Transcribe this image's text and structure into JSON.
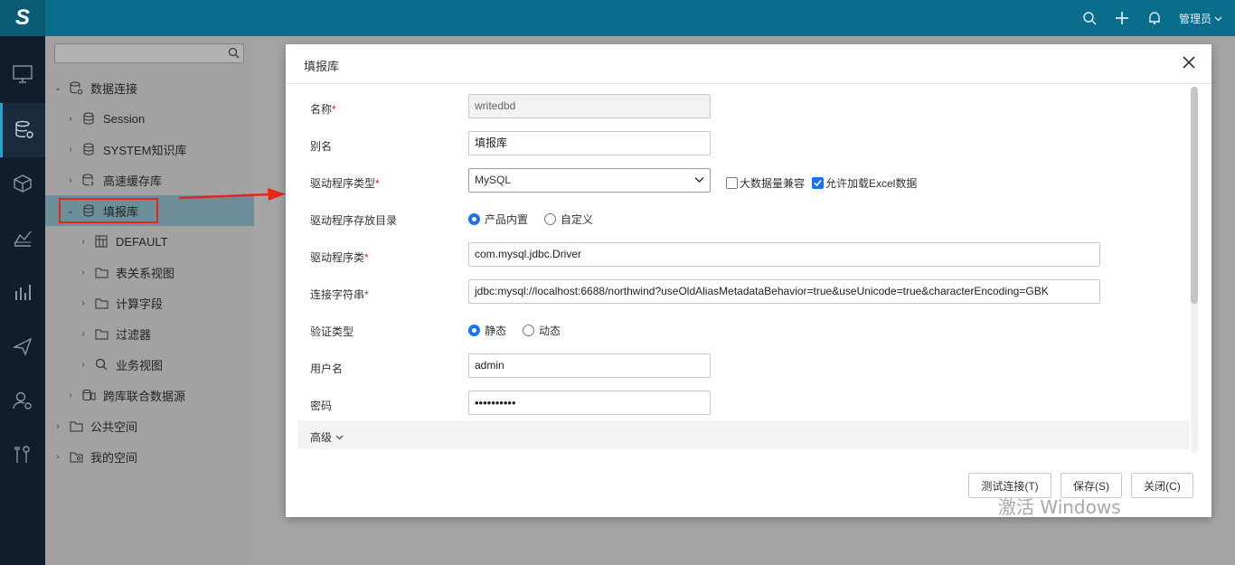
{
  "topbar": {
    "logo": "S",
    "user_label": "管理员",
    "icons": [
      "search-icon",
      "plus-icon",
      "bell-icon"
    ]
  },
  "rail": {
    "items": [
      "monitor-icon",
      "database-icon",
      "cube-icon",
      "chart-area-icon",
      "bar-chart-icon",
      "send-icon",
      "user-settings-icon",
      "tools-icon"
    ],
    "active_index": 1
  },
  "tree": {
    "search_placeholder": "",
    "items": [
      {
        "label": "数据连接",
        "icon": "database-settings-icon"
      },
      {
        "label": "Session",
        "icon": "database-icon"
      },
      {
        "label": "SYSTEM知识库",
        "icon": "database-icon"
      },
      {
        "label": "高速缓存库",
        "icon": "database-cache-icon"
      },
      {
        "label": "填报库",
        "icon": "database-icon"
      },
      {
        "label": "DEFAULT",
        "icon": "table-icon"
      },
      {
        "label": "表关系视图",
        "icon": "folder-icon"
      },
      {
        "label": "计算字段",
        "icon": "folder-icon"
      },
      {
        "label": "过滤器",
        "icon": "folder-icon"
      },
      {
        "label": "业务视图",
        "icon": "search-icon"
      },
      {
        "label": "跨库联合数据源",
        "icon": "multi-db-icon"
      },
      {
        "label": "公共空间",
        "icon": "folder-icon"
      },
      {
        "label": "我的空间",
        "icon": "user-folder-icon"
      }
    ]
  },
  "dialog": {
    "title": "填报库",
    "fields": {
      "name": {
        "label": "名称",
        "value": "writedbd"
      },
      "alias": {
        "label": "别名",
        "value": "填报库"
      },
      "driver_type": {
        "label": "驱动程序类型",
        "value": "MySQL"
      },
      "big_data_compat": {
        "label": "大数据量兼容",
        "checked": false
      },
      "allow_excel": {
        "label": "允许加载Excel数据",
        "checked": true
      },
      "driver_dir": {
        "label": "驱动程序存放目录",
        "options": [
          "产品内置",
          "自定义"
        ],
        "selected": "产品内置"
      },
      "driver_class": {
        "label": "驱动程序类",
        "value": "com.mysql.jdbc.Driver"
      },
      "conn_string": {
        "label": "连接字符串",
        "value": "jdbc:mysql://localhost:6688/northwind?useOldAliasMetadataBehavior=true&useUnicode=true&characterEncoding=GBK"
      },
      "auth_type": {
        "label": "验证类型",
        "options": [
          "静态",
          "动态"
        ],
        "selected": "静态"
      },
      "username": {
        "label": "用户名",
        "value": "admin"
      },
      "password": {
        "label": "密码",
        "value": "••••••••••"
      }
    },
    "advanced_label": "高级",
    "buttons": {
      "test": "测试连接(T)",
      "save": "保存(S)",
      "close": "关闭(C)"
    }
  },
  "watermark": "激活 Windows",
  "colors": {
    "topbar": "#0a6d8c",
    "rail": "#101d2c",
    "accent": "#1a73e8",
    "highlight_box": "#e8251d",
    "selected_row": "#9ccbdc"
  }
}
